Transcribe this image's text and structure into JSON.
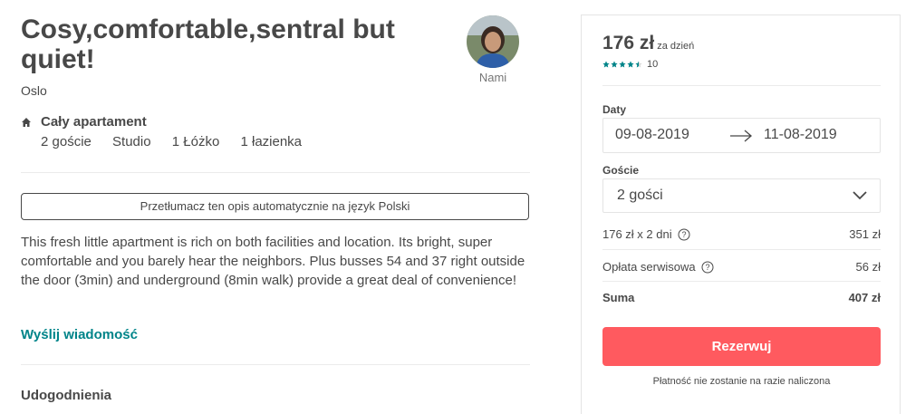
{
  "listing": {
    "title": "Cosy,comfortable,sentral but quiet!",
    "city": "Oslo",
    "host_name": "Nami",
    "type_title": "Cały apartament",
    "features": [
      "2 goście",
      "Studio",
      "1 Łóżko",
      "1 łazienka"
    ],
    "translate_label": "Przetłumacz ten opis automatycznie na język Polski",
    "description": "This fresh little apartment is rich on both facilities and location. Its bright, super comfortable and you barely hear the neighbors. Plus busses 54 and 37 right outside the door (3min) and underground (8min walk) provide a great deal of convenience!",
    "message_link": "Wyślij wiadomość",
    "amenities_heading": "Udogodnienia"
  },
  "booking": {
    "price": "176 zł",
    "price_unit": "za dzień",
    "rating_stars": 4.5,
    "rating_count": "10",
    "dates_label": "Daty",
    "check_in": "09-08-2019",
    "check_out": "11-08-2019",
    "guests_label": "Goście",
    "guests_value": "2 gości",
    "nights_label": "176 zł x 2 dni",
    "nights_value": "351 zł",
    "service_label": "Opłata serwisowa",
    "service_value": "56 zł",
    "total_label": "Suma",
    "total_value": "407 zł",
    "reserve_label": "Rezerwuj",
    "note": "Płatność nie zostanie na razie naliczona"
  },
  "colors": {
    "text": "#484848",
    "accent_teal": "#008489",
    "brand_red": "#ff5a5f",
    "divider": "#ebebeb"
  },
  "icons": [
    "home-icon",
    "star-icon",
    "arrow-right-icon",
    "chevron-down-icon",
    "question-circle-icon"
  ]
}
